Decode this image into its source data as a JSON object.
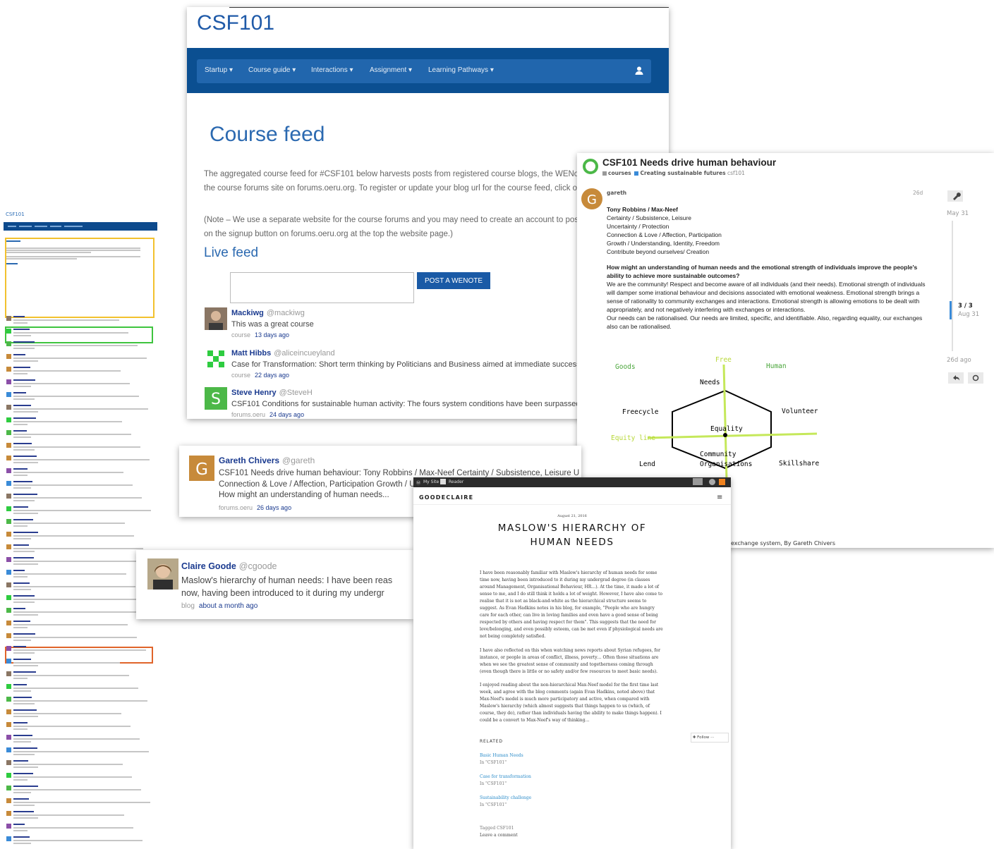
{
  "mini": {
    "title": "CSF101"
  },
  "main": {
    "brand": "CSF101",
    "nav": [
      "Startup",
      "Course guide",
      "Interactions",
      "Assignment",
      "Learning Pathways"
    ],
    "heading": "Course feed",
    "para1": "The aggregated course feed for #CSF101 below harvests posts from registered course blogs, the WENotes course feed, and the course forums site on forums.oeru.org. To register or update your blog url for the course feed, click on the link above.",
    "para2": "(Note – We use a separate website for the course forums and you may need to create an account to post on the forums. Click on the signup button on forums.oeru.org at the top the website page.)",
    "live": "Live feed",
    "post_button": "POST A WENOTE",
    "entries": [
      {
        "name": "Mackiwg",
        "handle": "@mackiwg",
        "text": "This was a great course",
        "src": "course",
        "when": "13 days ago"
      },
      {
        "name": "Matt Hibbs",
        "handle": "@aliceincueyland",
        "text": "Case for Transformation: Short term thinking by Politicians and Business aimed at immediate success.",
        "src": "course",
        "when": "22 days ago"
      },
      {
        "name": "Steve Henry",
        "handle": "@SteveH",
        "text": "CSF101 Conditions for sustainable human activity: The fours system conditions have been surpassed by th",
        "src": "forums.oeru",
        "when": "24 days ago"
      }
    ]
  },
  "forum": {
    "title": "CSF101 Needs drive human behaviour",
    "crumb1": "courses",
    "crumb2": "Creating sustainable futures",
    "crumb3": "csf101",
    "author": "gareth",
    "age": "26d",
    "lines1": [
      "Tony Robbins / Max-Neef",
      "Certainty / Subsistence, Leisure",
      "Uncertainty / Protection",
      "Connection & Love / Affection, Participation",
      "Growth / Understanding, Identity, Freedom",
      "Contribute beyond ourselves/ Creation"
    ],
    "q": "How might an understanding of human needs and the emotional strength of individuals improve the people's ability to achieve more sustainable outcomes?",
    "a": "We are the community! Respect and become aware of all individuals (and their needs). Emotional strength of individuals will damper some irrational behaviour and decisions associated with emotional weakness. Emotional strength brings a sense of rationality to community exchanges and interactions. Emotional strength is allowing emotions to be dealt with appropriately, and not negatively interfering with exchanges or interactions.",
    "a2": "Our needs can be rationalised. Our needs are limited, specific, and identifiable. Also, regarding equality, our exchanges also can be rationalised.",
    "timeline_start": "May 31",
    "timeline_pos": "3 / 3",
    "timeline_date": "Aug 31",
    "timeline_end": "26d ago",
    "caption": "exchange system, By Gareth Chivers",
    "diagram": {
      "goods": "Goods",
      "free": "Free",
      "human": "Human",
      "needs": "Needs",
      "freecycle": "Freecycle",
      "volunteer": "Volunteer",
      "equality": "Equality",
      "equity": "Equity line",
      "community": "Community",
      "orgs": "Organisations",
      "lend": "Lend",
      "skillshare": "Skillshare",
      "e": "e"
    }
  },
  "gareth": {
    "name": "Gareth Chivers",
    "handle": "@gareth",
    "l1": "CSF101 Needs drive human behaviour: Tony Robbins / Max-Neef Certainty / Subsistence, Leisure U",
    "l2": "Connection & Love / Affection, Participation Growth / U",
    "l3": "How might an understanding of human needs...",
    "src": "forums.oeru",
    "when": "26 days ago"
  },
  "blog": {
    "bar_mysite": "My Site",
    "bar_reader": "Reader",
    "site": "GOODECLAIRE",
    "date": "August 21, 2016",
    "title1": "MASLOW'S HIERARCHY OF",
    "title2": "HUMAN NEEDS",
    "p1": "I have been reasonably familiar with Maslow's hierarchy of human needs for some time now, having been introduced to it during my undergrad degree (in classes around Management, Organisational Behaviour, HR…). At the time, it made a lot of sense to me, and I do still think it holds a lot of weight. However, I have also come to realise that it is not as black-and-white as the hierarchical structure seems to suggest. As Evan Hadkins notes in his blog, for example, \"People who are hungry care for each other, can live in loving families and even have a good sense of being respected by others and having respect for them\". This suggests that the need for love/belonging, and even possibly esteem, can be met even if physiological needs are not being completely satisfied.",
    "p2": "I have also reflected on this when watching news reports about Syrian refugees, for instance, or people in areas of conflict, illness, poverty… Often those situations are when we see the greatest sense of community and togetherness coming through (even though there is little or no safety and/or few resources to meet basic needs).",
    "p3": "I enjoyed reading about the non-hierarchical Max-Neef model for the first time last week, and agree with the blog comments (again Evan Hadkins, noted above) that Max-Neef's model is much more participatory and active, when compared with Maslow's hierarchy (which almost suggests that things happen to us (which, of course, they do), rather than individuals having the ability to make things happen). I could be a convert to Max-Neef's way of thinking…",
    "related": "RELATED",
    "follow": "Follow",
    "rel": [
      {
        "t": "Basic Human Needs",
        "s": "In \"CSF101\""
      },
      {
        "t": "Case for transformation",
        "s": "In \"CSF101\""
      },
      {
        "t": "Sustainability challenge",
        "s": "In \"CSF101\""
      }
    ],
    "tagged": "Tagged CSF101",
    "comment": "Leave a comment"
  },
  "claire": {
    "name": "Claire Goode",
    "handle": "@cgoode",
    "l1": "Maslow's hierarchy of human needs: I have been reas",
    "l2": "now, having been introduced to it during my undergr",
    "src": "blog",
    "when": "about a month ago"
  }
}
